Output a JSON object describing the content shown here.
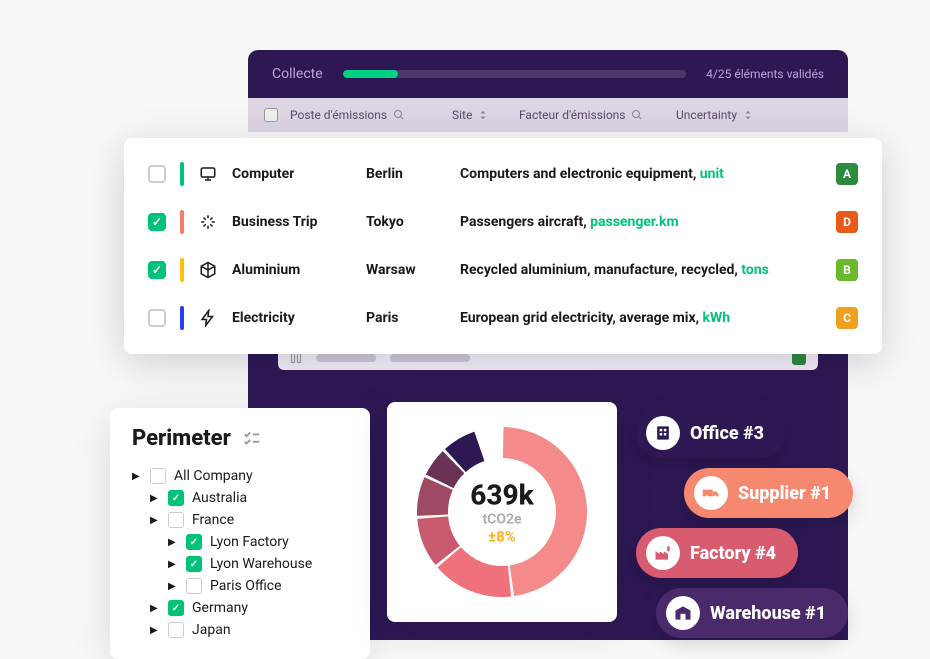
{
  "topbar": {
    "label": "Collecte",
    "progress_text": "4/25 éléments validés",
    "progress_pct": 16
  },
  "headers": {
    "poste": "Poste d'émissions",
    "site": "Site",
    "facteur": "Facteur d'émissions",
    "uncertainty": "Uncertainty"
  },
  "rows": [
    {
      "checked": false,
      "accent": "#00c278",
      "icon": "computer",
      "poste": "Computer",
      "site": "Berlin",
      "factor_text": "Computers and electronic equipment, ",
      "unit": "unit",
      "badge": "A",
      "badge_color": "#2d8a3e"
    },
    {
      "checked": true,
      "accent": "#f37c6f",
      "icon": "plane",
      "poste": "Business Trip",
      "site": "Tokyo",
      "factor_text": "Passengers aircraft, ",
      "unit": "passenger.km",
      "badge": "D",
      "badge_color": "#e85a1a"
    },
    {
      "checked": true,
      "accent": "#ffc107",
      "icon": "cube",
      "poste": "Aluminium",
      "site": "Warsaw",
      "factor_text": "Recycled aluminium, manufacture, recycled, ",
      "unit": "tons",
      "badge": "B",
      "badge_color": "#6ab82b"
    },
    {
      "checked": false,
      "accent": "#2a3bff",
      "icon": "bolt",
      "poste": "Electricity",
      "site": "Paris",
      "factor_text": "European grid electricity, average mix, ",
      "unit": "kWh",
      "badge": "C",
      "badge_color": "#f0a020"
    }
  ],
  "perimeter": {
    "title": "Perimeter",
    "items": [
      {
        "label": "All Company",
        "checked": false,
        "indent": 0
      },
      {
        "label": "Australia",
        "checked": true,
        "indent": 1
      },
      {
        "label": "France",
        "checked": false,
        "indent": 1
      },
      {
        "label": "Lyon Factory",
        "checked": true,
        "indent": 2
      },
      {
        "label": "Lyon Warehouse",
        "checked": true,
        "indent": 2
      },
      {
        "label": "Paris Office",
        "checked": false,
        "indent": 2
      },
      {
        "label": "Germany",
        "checked": true,
        "indent": 1
      },
      {
        "label": "Japan",
        "checked": false,
        "indent": 1
      }
    ]
  },
  "chart_data": {
    "type": "pie",
    "title": "",
    "center_value": "639k",
    "center_unit": "tCO2e",
    "center_pct": "±8%",
    "series": [
      {
        "name": "slice-1",
        "value": 48,
        "color": "#f48a8a"
      },
      {
        "name": "slice-2",
        "value": 16,
        "color": "#f0707c"
      },
      {
        "name": "slice-3",
        "value": 10,
        "color": "#c95a6e"
      },
      {
        "name": "slice-4",
        "value": 8,
        "color": "#9d4a62"
      },
      {
        "name": "slice-5",
        "value": 6,
        "color": "#6a3356"
      },
      {
        "name": "slice-6",
        "value": 7,
        "color": "#2d1854"
      },
      {
        "name": "gap",
        "value": 5,
        "color": "transparent"
      }
    ]
  },
  "pills": [
    {
      "label": "Office #3",
      "icon": "building",
      "bg": "#2d1854",
      "icon_color": "#2d1854"
    },
    {
      "label": "Supplier #1",
      "icon": "truck",
      "bg": "#f5886f",
      "icon_color": "#f5886f"
    },
    {
      "label": "Factory #4",
      "icon": "factory",
      "bg": "#d95b6f",
      "icon_color": "#d95b6f"
    },
    {
      "label": "Warehouse #1",
      "icon": "warehouse",
      "bg": "#4a2a6a",
      "icon_color": "#4a2a6a"
    }
  ]
}
